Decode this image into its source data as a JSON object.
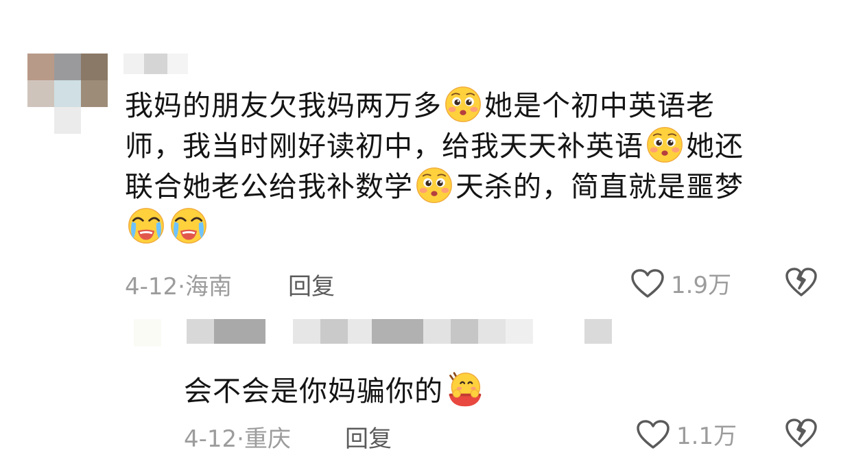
{
  "comment": {
    "text_segments": [
      "我妈的朋友欠我妈两万多",
      "她是个初中英语老",
      "师，我当时刚好读初中，给我天天补英语",
      "她还",
      "联合她老公给我补数学",
      "天杀的，简直就是噩梦"
    ],
    "emoji_names": [
      "pleading-face-emoji",
      "crying-face-emoji",
      "laughing-eating-emoji"
    ],
    "date": "4-12",
    "dot": "·",
    "location": "海南",
    "reply_label": "回复",
    "like_count": "1.9万"
  },
  "reply": {
    "text": "会不会是你妈骗你的",
    "date": "4-12",
    "dot": "·",
    "location": "重庆",
    "reply_label": "回复",
    "like_count": "1.1万"
  },
  "colors": {
    "text": "#141414",
    "meta": "#9c9c9c",
    "emoji_face": "#ffd13d",
    "emoji_blush": "#ff7c7c"
  }
}
